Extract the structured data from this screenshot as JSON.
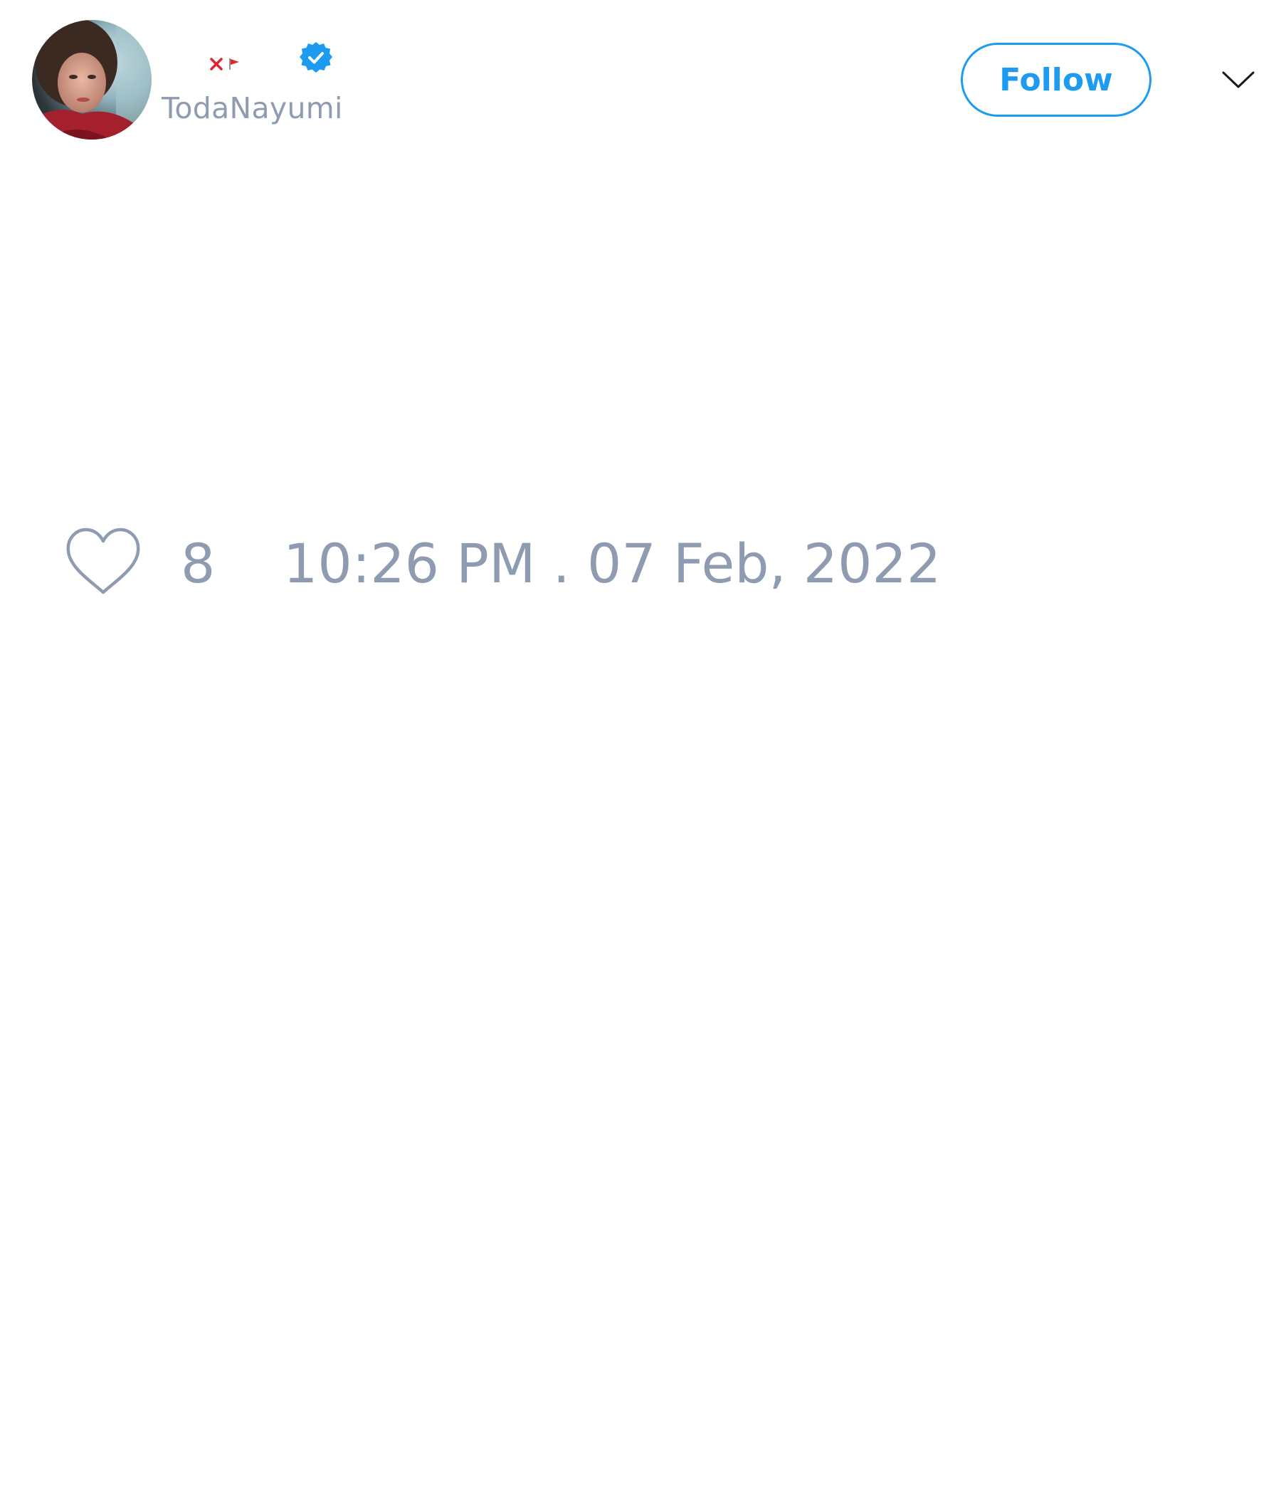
{
  "tweet": {
    "author": {
      "display_name_emoji": [
        "cross-mark-icon",
        "triangular-flag-icon"
      ],
      "handle": "TodaNayumi",
      "verified": true
    },
    "follow_label": "Follow",
    "like_count": "8",
    "timestamp": "10:26 PM . 07 Feb, 2022"
  },
  "colors": {
    "accent": "#1d9bf0",
    "muted_text": "#8e9bb0",
    "emoji_red": "#e0242e"
  },
  "icons": {
    "avatar": "avatar",
    "verified": "verified-badge-icon",
    "more": "chevron-down-icon",
    "like": "heart-icon"
  }
}
